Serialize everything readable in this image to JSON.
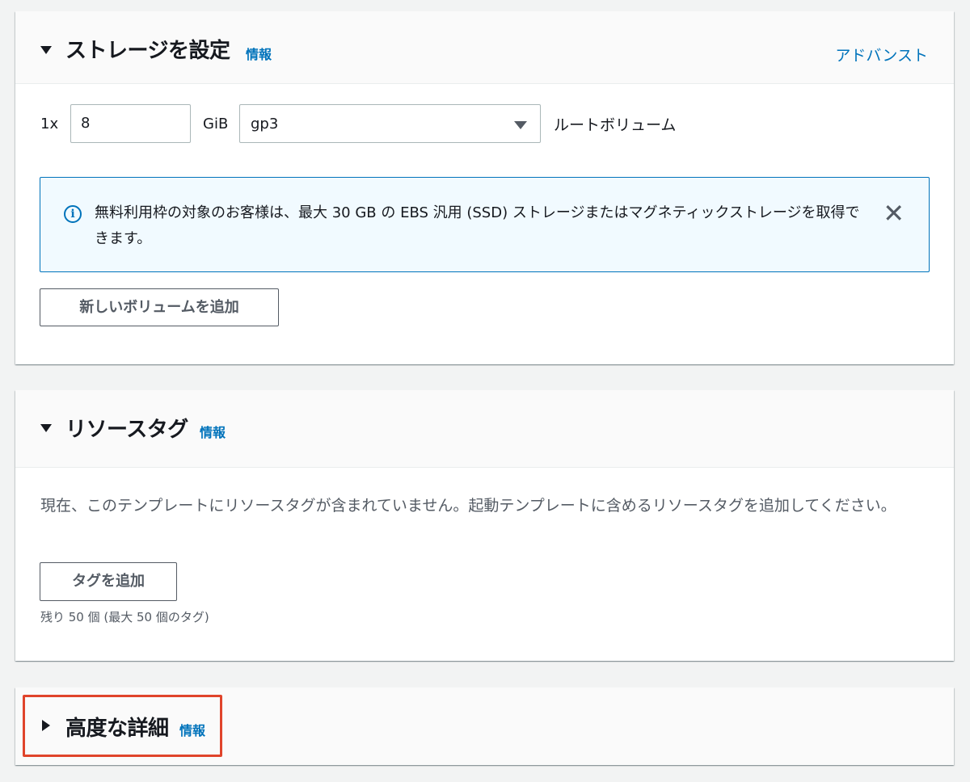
{
  "storage": {
    "title": "ストレージを設定",
    "info": "情報",
    "advanced": "アドバンスト",
    "count_label": "1x",
    "size_value": "8",
    "unit_label": "GiB",
    "volume_type": "gp3",
    "root_label": "ルートボリューム",
    "alert_text": "無料利用枠の対象のお客様は、最大 30 GB の EBS 汎用 (SSD) ストレージまたはマグネティックストレージを取得できます。",
    "close_glyph": "✕",
    "add_volume_button": "新しいボリュームを追加"
  },
  "tags": {
    "title": "リソースタグ",
    "info": "情報",
    "description": "現在、このテンプレートにリソースタグが含まれていません。起動テンプレートに含めるリソースタグを追加してください。",
    "add_tag_button": "タグを追加",
    "remaining": "残り 50 個 (最大 50 個のタグ)"
  },
  "advanced_details": {
    "title": "高度な詳細",
    "info": "情報"
  },
  "colors": {
    "link": "#0073bb",
    "highlight": "#e0442b"
  }
}
